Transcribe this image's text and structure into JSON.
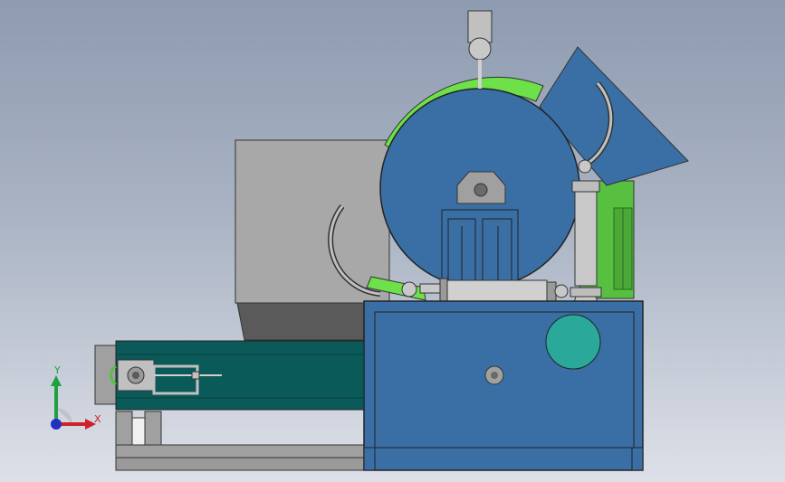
{
  "viewport": {
    "description_visible": false
  },
  "triad": {
    "x_label": "X",
    "y_label": "Y",
    "colors": {
      "x": "#d0202a",
      "y": "#20a040",
      "z": "#2030c0"
    }
  },
  "colors": {
    "hopper_light": "#a8a8a8",
    "hopper_dark": "#5a5a5a",
    "drum_blue": "#3a6fa5",
    "green_band": "#6ee04a",
    "green_panel": "#58c040",
    "conveyor": "#0b5a5a",
    "frame_gray": "#9a9a9a",
    "cabinet_blue": "#3a6fa5",
    "motor_teal": "#2aa89a",
    "steel": "#c8c8c8"
  }
}
